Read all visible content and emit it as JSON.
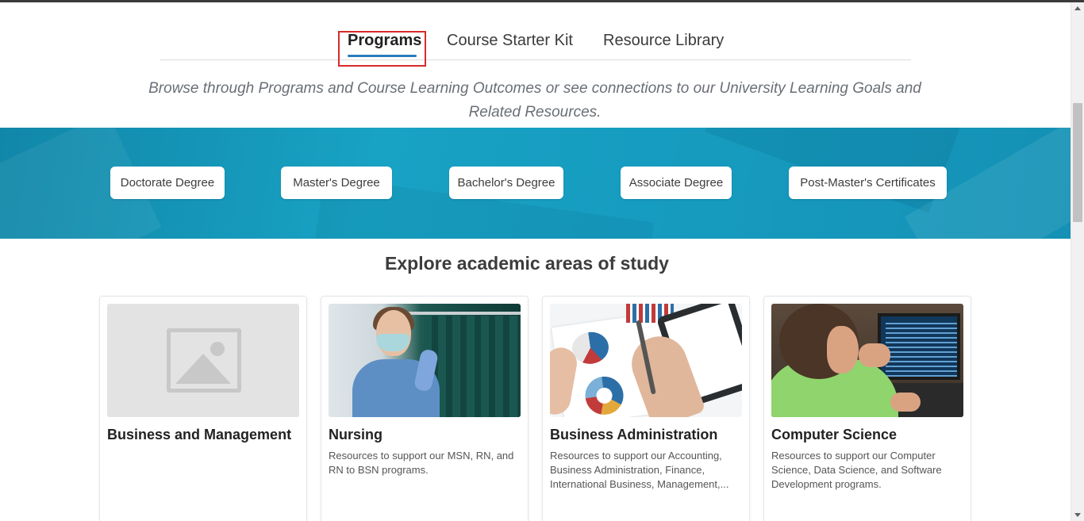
{
  "tabs": [
    {
      "label": "Programs",
      "active": true
    },
    {
      "label": "Course Starter Kit",
      "active": false
    },
    {
      "label": "Resource Library",
      "active": false
    }
  ],
  "subtitle": {
    "line1": "Browse through Programs and Course Learning Outcomes or see connections to our University Learning Goals and",
    "line2": "Related Resources."
  },
  "degree_filters": [
    "Doctorate Degree",
    "Master's Degree",
    "Bachelor's Degree",
    "Associate Degree",
    "Post-Master's Certificates"
  ],
  "explore": {
    "title": "Explore academic areas of study"
  },
  "cards": [
    {
      "title": "Business and Management",
      "description": "",
      "image": "image-placeholder-icon"
    },
    {
      "title": "Nursing",
      "description": "Resources to support our MSN, RN, and RN to BSN programs.",
      "image": "nurse-photo"
    },
    {
      "title": "Business Administration",
      "description": "Resources to support our Accounting, Business Administration, Finance, International Business, Management,...",
      "image": "business-charts-photo"
    },
    {
      "title": "Computer Science",
      "description": "Resources to support our Computer Science, Data Science, and Software Development programs.",
      "image": "programmer-photo"
    }
  ],
  "colors": {
    "banner": "#18a2c4",
    "tab_underline": "#2a7bbf",
    "highlight_box": "#d62b2b"
  }
}
